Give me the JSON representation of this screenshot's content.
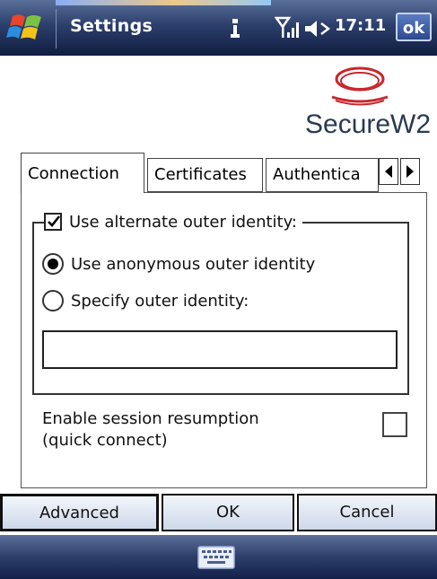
{
  "titlebar": {
    "title": "Settings",
    "clock": "17:11",
    "ok_label": "ok",
    "icons": [
      "windows-start-icon",
      "connectivity-icon",
      "signal-strength-icon",
      "speaker-icon"
    ]
  },
  "logo": {
    "text": "SecureW2"
  },
  "tabs": [
    {
      "label": "Connection",
      "active": true
    },
    {
      "label": "Certificates",
      "active": false
    },
    {
      "label": "Authentica",
      "active": false
    }
  ],
  "connection": {
    "alternate_identity": {
      "label": "Use alternate outer identity:",
      "checked": true
    },
    "radio_options": [
      {
        "label": "Use anonymous outer identity",
        "selected": true
      },
      {
        "label": "Specify outer identity:",
        "selected": false
      }
    ],
    "outer_identity_value": "",
    "session_resumption": {
      "line1": "Enable session resumption",
      "line2": "(quick connect)",
      "checked": false
    }
  },
  "buttons": {
    "advanced": "Advanced",
    "ok": "OK",
    "cancel": "Cancel"
  },
  "softkey": {
    "icon": "keyboard-icon"
  },
  "colors": {
    "bar_dark": "#101d3f",
    "bar_light": "#5a6f9a",
    "logo_red": "#c8282d",
    "logo_text": "#2a3a52"
  }
}
